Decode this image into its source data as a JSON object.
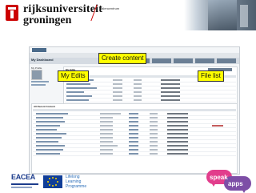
{
  "header": {
    "university_line1": "rijksuniversiteit",
    "university_line2": "groningen",
    "faculty": "talencentrum"
  },
  "screenshot": {
    "title": "My Dashboard",
    "side_label": "My Profile",
    "panel_edits_heading": "My Edits",
    "panel_recent_heading": "All Recent Content"
  },
  "callouts": {
    "create_content": "Create content",
    "my_edits": "My Edits",
    "file_list": "File list"
  },
  "footer": {
    "eacea": "EACEA",
    "llp_line1": "Lifelong",
    "llp_line2": "Learning",
    "llp_line3": "Programme",
    "speak": "speak",
    "apps": "apps"
  },
  "colors": {
    "callout_bg": "#ffff00",
    "brand_red": "#cc0000",
    "speak_pink": "#e23d8c",
    "apps_purple": "#7d4ea6"
  },
  "icons": {
    "crest": "university-crest-icon",
    "eu_flag": "eu-flag-icon"
  }
}
